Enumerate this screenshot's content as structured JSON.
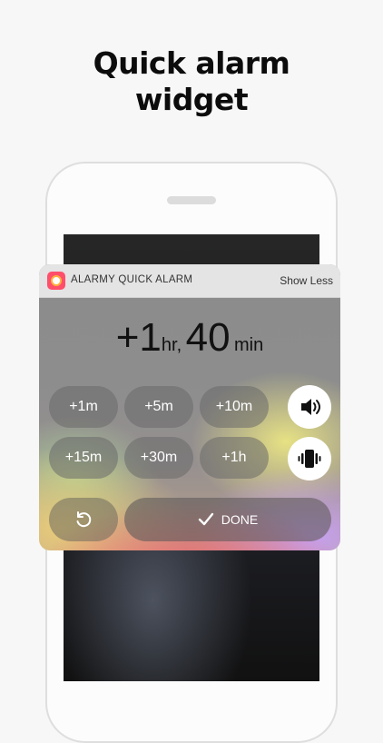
{
  "headline": {
    "line1": "Quick alarm",
    "line2": "widget"
  },
  "widget": {
    "app_title": "ALARMY QUICK ALARM",
    "show_less": "Show Less",
    "duration": {
      "hours": "+1",
      "hours_unit": "hr,",
      "minutes": "40",
      "minutes_unit": "min"
    },
    "increments_row1": [
      "+1m",
      "+5m",
      "+10m"
    ],
    "increments_row2": [
      "+15m",
      "+30m",
      "+1h"
    ],
    "done_label": "DONE",
    "icons": {
      "sound": "speaker-icon",
      "vibrate": "vibrate-icon",
      "undo": "undo-icon",
      "done": "checkmark-icon",
      "app": "alarm-clock-icon"
    }
  },
  "colors": {
    "app_icon": "#ff4f6a",
    "app_icon_ring": "#ffb23e"
  }
}
